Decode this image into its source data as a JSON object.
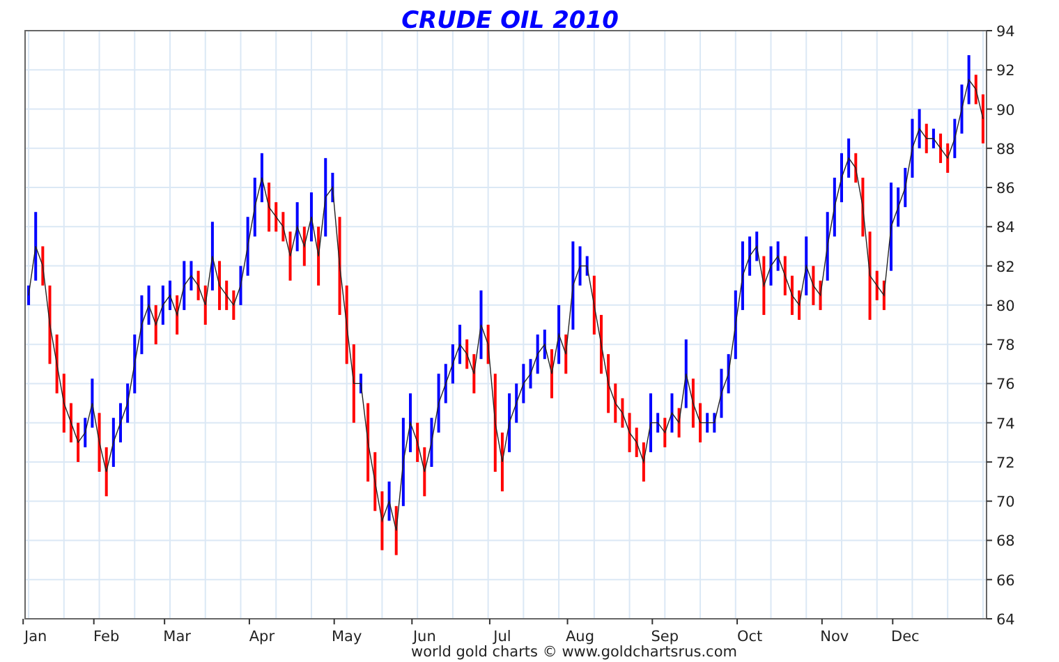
{
  "chart": {
    "chart_data": {
      "type": "line",
      "title": "CRUDE OIL 2010",
      "grid": true,
      "categories": [
        null,
        "Jan",
        null,
        null,
        null,
        null,
        null,
        null,
        null,
        null,
        null,
        "Feb",
        null,
        null,
        null,
        null,
        null,
        null,
        null,
        null,
        null,
        "Mar",
        null,
        null,
        null,
        null,
        null,
        null,
        null,
        null,
        null,
        null,
        null,
        "Apr",
        null,
        null,
        null,
        null,
        null,
        null,
        null,
        null,
        null,
        null,
        null,
        "May",
        null,
        null,
        null,
        null,
        null,
        null,
        null,
        null,
        null,
        null,
        "Jun",
        null,
        null,
        null,
        null,
        null,
        null,
        null,
        null,
        null,
        null,
        "Jul",
        null,
        null,
        null,
        null,
        null,
        null,
        null,
        null,
        null,
        null,
        "Aug",
        null,
        null,
        null,
        null,
        null,
        null,
        null,
        null,
        null,
        null,
        null,
        "Sep",
        null,
        null,
        null,
        null,
        null,
        null,
        null,
        null,
        null,
        null,
        null,
        "Oct",
        null,
        null,
        null,
        null,
        null,
        null,
        null,
        null,
        null,
        null,
        null,
        "Nov",
        null,
        null,
        null,
        null,
        null,
        null,
        null,
        null,
        null,
        "Dec",
        null,
        null,
        null,
        null,
        null,
        null,
        null,
        null,
        null,
        null,
        null
      ],
      "ylim": [
        64,
        94
      ],
      "yticks": [
        64,
        66,
        68,
        70,
        72,
        74,
        76,
        78,
        80,
        82,
        84,
        86,
        88,
        90,
        92,
        94
      ],
      "series": [
        {
          "color": "#222222",
          "errors": [
            0.5,
            1.75,
            1,
            2,
            1.5,
            1.5,
            1,
            1,
            0.75,
            1.25,
            1.5,
            1.25,
            1.25,
            1,
            1,
            1.5,
            1.5,
            1,
            1,
            1,
            0.75,
            1,
            1.25,
            0.75,
            0.75,
            1,
            1.75,
            1.25,
            0.75,
            0.75,
            1,
            1.5,
            1.5,
            1.25,
            1.25,
            0.75,
            0.75,
            1.25,
            1.25,
            1,
            1.25,
            1.5,
            2,
            0.75,
            2.5,
            2,
            2,
            0.5,
            2,
            1.5,
            1.5,
            1,
            1.25,
            2.25,
            1.5,
            1,
            1.25,
            1.25,
            1.5,
            1,
            1,
            1,
            0.75,
            1,
            1.75,
            1,
            2.5,
            1.5,
            1.5,
            1,
            1,
            0.75,
            1,
            0.75,
            1.25,
            1.5,
            1,
            2.25,
            1,
            0.5,
            1.5,
            1.5,
            1.5,
            1,
            0.75,
            1,
            0.75,
            1,
            1.5,
            0.5,
            0.75,
            1,
            0.75,
            1.75,
            1.25,
            1,
            0.5,
            0.5,
            1.25,
            1,
            1.75,
            1.75,
            1,
            0.75,
            1.5,
            1,
            0.75,
            1,
            1,
            0.75,
            1.5,
            1,
            0.75,
            1.75,
            1.5,
            1.25,
            1,
            0.75,
            1.5,
            2.25,
            0.75,
            0.75,
            2.25,
            1,
            1,
            1.5,
            1,
            0.75,
            0.5,
            0.75,
            0.75,
            1,
            1.25,
            1.25,
            0.75,
            1.25
          ],
          "values": [
            80.5,
            83,
            82,
            79,
            77,
            75,
            74,
            73,
            73.5,
            75,
            73,
            71.5,
            73,
            74,
            75,
            77,
            79,
            80,
            79,
            80,
            80.5,
            79.5,
            81,
            81.5,
            81,
            80,
            82.5,
            81,
            80.5,
            80,
            81,
            83,
            85,
            86.5,
            85,
            84.5,
            84,
            82.5,
            84,
            83,
            84.5,
            82.5,
            85.5,
            86,
            82,
            79,
            76,
            76,
            73,
            71,
            69,
            70,
            68.5,
            72,
            74,
            73,
            71.5,
            73,
            75,
            76,
            77,
            78,
            77.5,
            76.5,
            79,
            78,
            74,
            72,
            74,
            75,
            76,
            76.5,
            77.5,
            78,
            76.5,
            78.5,
            77.5,
            81,
            82,
            82,
            80,
            78,
            76,
            75,
            74.5,
            73.5,
            73,
            72,
            74,
            74,
            73.5,
            74.5,
            74,
            76.5,
            75,
            74,
            74,
            74,
            75.5,
            76.5,
            79,
            81.5,
            82.5,
            83,
            81,
            82,
            82.5,
            81.5,
            80.5,
            80,
            82,
            81,
            80.5,
            83,
            85,
            86.5,
            87.5,
            87,
            85,
            81.5,
            81,
            80.5,
            84,
            85,
            86,
            88,
            89,
            88.5,
            88.5,
            88,
            87.5,
            88.5,
            90,
            91.5,
            91,
            89.5
          ]
        }
      ]
    }
  },
  "footer": "world gold charts © www.goldchartsrus.com"
}
